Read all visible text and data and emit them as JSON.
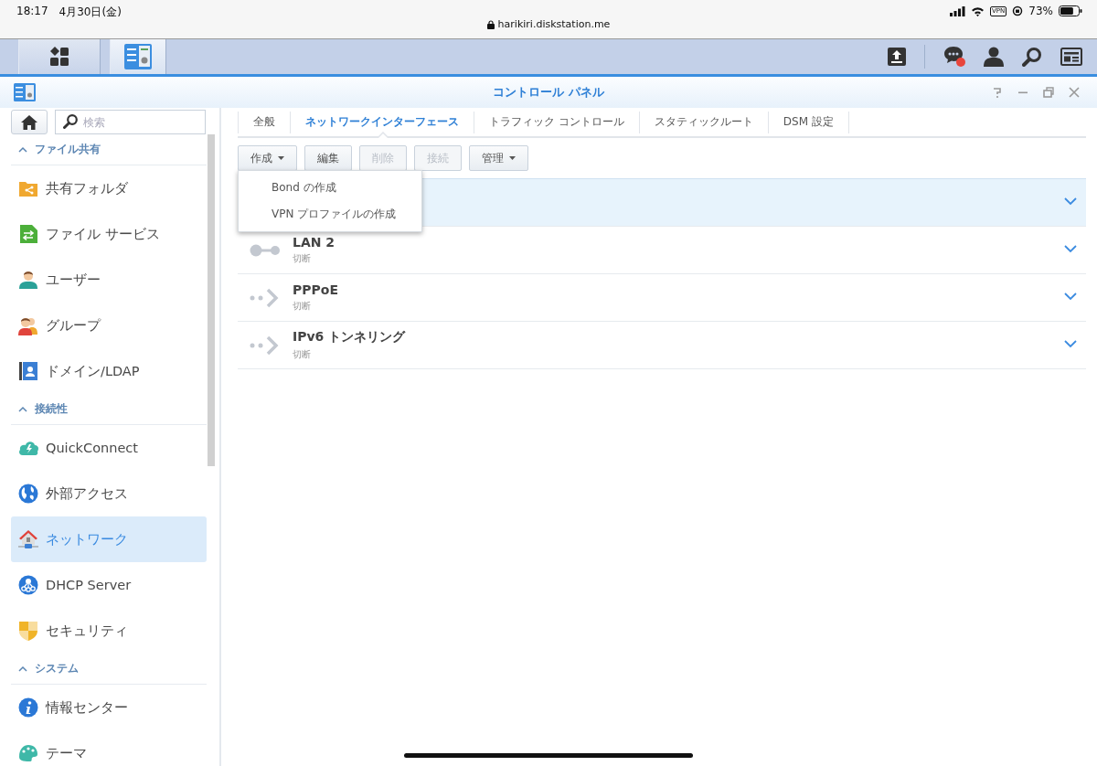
{
  "status_bar": {
    "time": "18:17",
    "date": "4月30日(金)",
    "url": "harikiri.diskstation.me",
    "vpn": "VPN",
    "battery": "73%"
  },
  "taskbar": {
    "apps": [
      {
        "kind": "main-menu",
        "selected": false
      },
      {
        "kind": "control-panel",
        "selected": true
      }
    ],
    "notification": true
  },
  "window": {
    "title": "コントロール パネル"
  },
  "sidebar": {
    "search": {
      "placeholder": "検索"
    },
    "sections": [
      {
        "title": "ファイル共有",
        "expanded": true,
        "items": [
          {
            "label": "共有フォルダ",
            "kind": "folder",
            "selected": false
          },
          {
            "label": "ファイル サービス",
            "kind": "file-service",
            "selected": false
          },
          {
            "label": "ユーザー",
            "kind": "user",
            "selected": false
          },
          {
            "label": "グループ",
            "kind": "group",
            "selected": false
          },
          {
            "label": "ドメイン/LDAP",
            "kind": "domain",
            "selected": false
          }
        ]
      },
      {
        "title": "接続性",
        "expanded": true,
        "items": [
          {
            "label": "QuickConnect",
            "kind": "cloud",
            "selected": false
          },
          {
            "label": "外部アクセス",
            "kind": "globe",
            "selected": false
          },
          {
            "label": "ネットワーク",
            "kind": "network",
            "selected": true
          },
          {
            "label": "DHCP Server",
            "kind": "dhcp",
            "selected": false
          },
          {
            "label": "セキュリティ",
            "kind": "shield",
            "selected": false
          }
        ]
      },
      {
        "title": "システム",
        "expanded": true,
        "items": [
          {
            "label": "情報センター",
            "kind": "info",
            "selected": false
          },
          {
            "label": "テーマ",
            "kind": "theme",
            "selected": false
          }
        ]
      }
    ]
  },
  "tabs": [
    {
      "label": "全般",
      "selected": false
    },
    {
      "label": "ネットワークインターフェース",
      "selected": true
    },
    {
      "label": "トラフィック コントロール",
      "selected": false
    },
    {
      "label": "スタティックルート",
      "selected": false
    },
    {
      "label": "DSM 設定",
      "selected": false
    }
  ],
  "toolbar": [
    {
      "label": "作成",
      "dropdown": true,
      "disabled": false
    },
    {
      "label": "編集",
      "dropdown": false,
      "disabled": false
    },
    {
      "label": "削除",
      "dropdown": false,
      "disabled": true
    },
    {
      "label": "接続",
      "dropdown": false,
      "disabled": true
    },
    {
      "label": "管理",
      "dropdown": true,
      "disabled": false
    }
  ],
  "create_menu": {
    "items": [
      "Bond の作成",
      "VPN プロファイルの作成"
    ]
  },
  "interfaces": [
    {
      "selected": true
    },
    {
      "name": "LAN 2",
      "status": "切断",
      "kind": "lan",
      "selected": false
    },
    {
      "name": "PPPoE",
      "status": "切断",
      "kind": "tunnel",
      "selected": false
    },
    {
      "name": "IPv6 トンネリング",
      "status": "切断",
      "kind": "tunnel",
      "selected": false
    }
  ]
}
